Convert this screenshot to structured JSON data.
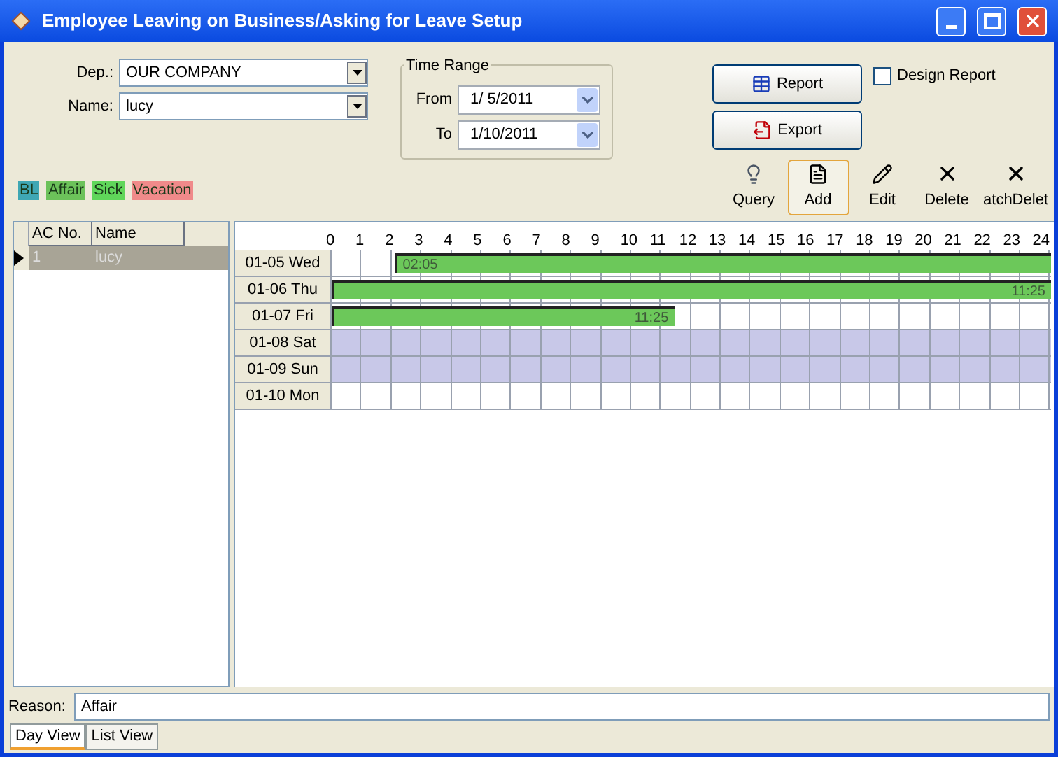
{
  "window": {
    "title": "Employee Leaving on Business/Asking for Leave Setup"
  },
  "filters": {
    "dep_label": "Dep.:",
    "dep_value": "OUR COMPANY",
    "name_label": "Name:",
    "name_value": "lucy"
  },
  "time_range": {
    "title": "Time Range",
    "from_label": "From",
    "from_value": "1/ 5/2011",
    "to_label": "To",
    "to_value": "1/10/2011"
  },
  "buttons": [
    {
      "label": "Report",
      "kind": "report"
    },
    {
      "label": "Export",
      "kind": "export"
    }
  ],
  "design_report": {
    "label": "Design Report",
    "checked": false
  },
  "legend": [
    {
      "label": "BL",
      "color": "#3fa7b4"
    },
    {
      "label": "Affair",
      "color": "#6cc25a"
    },
    {
      "label": "Sick",
      "color": "#5fd65a"
    },
    {
      "label": "Vacation",
      "color": "#f08a8a"
    }
  ],
  "toolbar": [
    {
      "label": "Query",
      "kind": "query",
      "selected": false
    },
    {
      "label": "Add",
      "kind": "add",
      "selected": true
    },
    {
      "label": "Edit",
      "kind": "edit",
      "selected": false
    },
    {
      "label": "Delete",
      "kind": "delete",
      "selected": false
    },
    {
      "label": "atchDelet",
      "kind": "delete",
      "selected": false
    }
  ],
  "employee_table": {
    "columns": [
      "AC No.",
      "Name"
    ],
    "rows": [
      {
        "ac_no": "1",
        "name": "lucy",
        "selected": true
      }
    ]
  },
  "schedule": {
    "hours": [
      "0",
      "1",
      "2",
      "3",
      "4",
      "5",
      "6",
      "7",
      "8",
      "9",
      "10",
      "11",
      "12",
      "13",
      "14",
      "15",
      "16",
      "17",
      "18",
      "19",
      "20",
      "21",
      "22",
      "23",
      "24"
    ],
    "rows": [
      {
        "day": "01-05 Wed",
        "weekend": false,
        "bar": {
          "level": 0.913,
          "kind": "tail",
          "label": "02:05"
        }
      },
      {
        "day": "01-06 Thu",
        "weekend": false,
        "bar": {
          "level": 1,
          "kind": "head",
          "label": "11:25"
        }
      },
      {
        "day": "01-07 Fri",
        "weekend": false,
        "bar": {
          "level": 0.476,
          "kind": "head",
          "label": "11:25"
        }
      },
      {
        "day": "01-08 Sat",
        "weekend": true
      },
      {
        "day": "01-09 Sun",
        "weekend": true
      },
      {
        "day": "01-10 Mon",
        "weekend": false
      }
    ]
  },
  "reason": {
    "label": "Reason:",
    "value": "Affair"
  },
  "view_tabs": [
    {
      "label": "Day View",
      "selected": true
    },
    {
      "label": "List View",
      "selected": false
    }
  ]
}
